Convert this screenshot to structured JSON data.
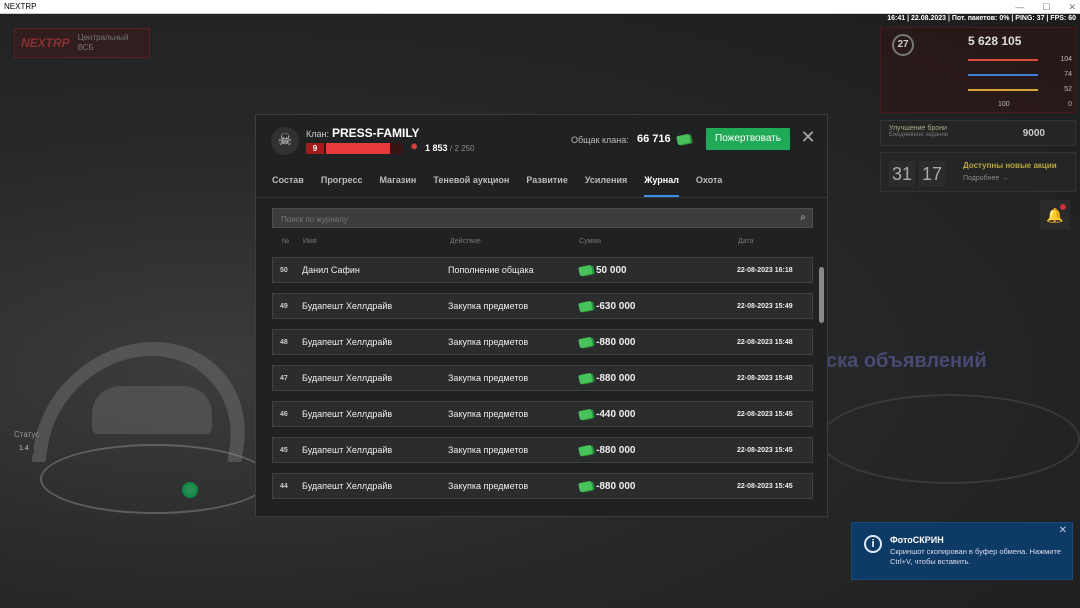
{
  "window": {
    "title": "NEXTRP",
    "controls": [
      "—",
      "☐",
      "✕"
    ]
  },
  "hud": {
    "status_line": "16:41 | 22.08.2023 | Пот. пакетов: 0% | PING: 37 | FPS: 60",
    "logo": "NEXTRP",
    "location": "Центральный",
    "location_sub": "ВСБ",
    "level": "27",
    "money": "5 628 105",
    "stats": [
      {
        "value": "104",
        "color": "#d84a3a"
      },
      {
        "value": "74",
        "color": "#3f7fd8"
      },
      {
        "value": "52",
        "color": "#d8a43a"
      },
      {
        "value": "0",
        "color": "#c33"
      }
    ],
    "stat_extra": "100",
    "upgrade_label": "Улучшение брони",
    "upgrade_sub": "Ежедневное задание",
    "upgrade_price": "9000",
    "timer": [
      "31",
      "17"
    ],
    "timer_title": "Доступны новые акции",
    "timer_sub": "Подробнее →",
    "stats_label": "Статус",
    "stats_value": "1.4",
    "bg_text": "ска объявлений"
  },
  "modal": {
    "clan_prefix": "Клан:",
    "clan_name": "PRESS-FAMILY",
    "clan_level": "9",
    "clan_points": "1 853",
    "clan_points_max": "/ 2 250",
    "treasury_label": "Общак клана:",
    "treasury_value": "66 716",
    "donate_label": "Пожертвовать",
    "close_label": "✕",
    "tabs": [
      "Состав",
      "Прогресс",
      "Магазин",
      "Теневой аукцион",
      "Развитие",
      "Усиления",
      "Журнал",
      "Охота"
    ],
    "active_tab": "Журнал",
    "search_placeholder": "Поиск по журналу",
    "columns": {
      "num": "№",
      "name": "Имя",
      "action": "Действие",
      "sum": "Сумма",
      "date": "Дата"
    },
    "rows": [
      {
        "num": "50",
        "name": "Данил Сафин",
        "action": "Пополнение общака",
        "sum": "50 000",
        "date": "22-08-2023 16:18"
      },
      {
        "num": "49",
        "name": "Будапешт Хеллдрайв",
        "action": "Закупка предметов",
        "sum": "-630 000",
        "date": "22-08-2023 15:49"
      },
      {
        "num": "48",
        "name": "Будапешт Хеллдрайв",
        "action": "Закупка предметов",
        "sum": "-880 000",
        "date": "22-08-2023 15:48"
      },
      {
        "num": "47",
        "name": "Будапешт Хеллдрайв",
        "action": "Закупка предметов",
        "sum": "-880 000",
        "date": "22-08-2023 15:48"
      },
      {
        "num": "46",
        "name": "Будапешт Хеллдрайв",
        "action": "Закупка предметов",
        "sum": "-440 000",
        "date": "22-08-2023 15:45"
      },
      {
        "num": "45",
        "name": "Будапешт Хеллдрайв",
        "action": "Закупка предметов",
        "sum": "-880 000",
        "date": "22-08-2023 15:45"
      },
      {
        "num": "44",
        "name": "Будапешт Хеллдрайв",
        "action": "Закупка предметов",
        "sum": "-880 000",
        "date": "22-08-2023 15:45"
      }
    ]
  },
  "toast": {
    "title": "ФотоСКРИН",
    "message": "Скриншот скопирован в буфер обмена. Нажмите Ctrl+V, чтобы вставить.",
    "close": "✕"
  },
  "icons": {
    "clan": "skull-icon",
    "points": "cog-icon",
    "money": "money-icon",
    "search": "search-icon",
    "bell": "bell-icon",
    "info": "info-icon"
  }
}
